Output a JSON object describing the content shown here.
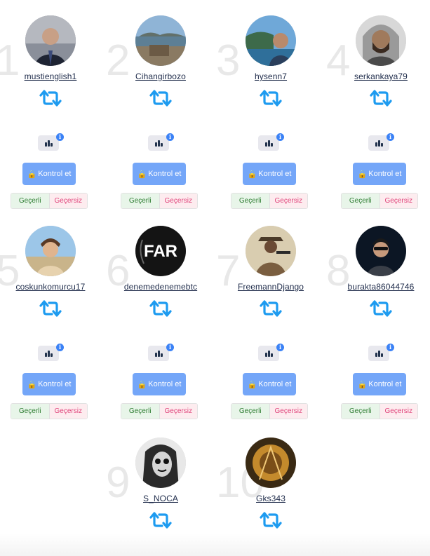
{
  "users": [
    {
      "rank": "1",
      "username": "mustienglish1"
    },
    {
      "rank": "2",
      "username": "Cihangirbozo"
    },
    {
      "rank": "3",
      "username": "hysenn7"
    },
    {
      "rank": "4",
      "username": "serkankaya79"
    },
    {
      "rank": "5",
      "username": "coskunkomurcu17"
    },
    {
      "rank": "6",
      "username": "denemedenemebtc"
    },
    {
      "rank": "7",
      "username": "FreemannDjango"
    },
    {
      "rank": "8",
      "username": "burakta86044746"
    },
    {
      "rank": "9",
      "username": "S_NOCA"
    },
    {
      "rank": "10",
      "username": "Gks343"
    }
  ],
  "labels": {
    "kontrol": "Kontrol et",
    "gecerli": "Geçerli",
    "gecersiz": "Geçersiz",
    "info": "i"
  },
  "colors": {
    "retweet": "#1d9bf0",
    "kontrol_bg": "#74a6f8",
    "gecerli_text": "#2e7d32",
    "gecersiz_text": "#e0457b",
    "info_badge": "#3b82f6"
  },
  "icons": {
    "retweet": "retweet-icon",
    "stats": "bar-chart-icon",
    "lock": "lock-icon",
    "info": "info-icon"
  },
  "avatar_text": {
    "u6": "FAR"
  }
}
